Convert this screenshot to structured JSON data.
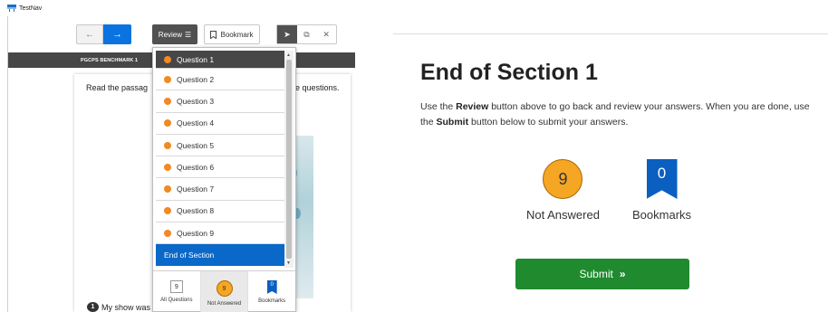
{
  "left": {
    "app_title": "TestNav",
    "section_title": "PGCPS BENCHMARK 1",
    "toolbar": {
      "prev_icon": "←",
      "next_icon": "→",
      "review_label": "Review",
      "review_icon": "☰",
      "bookmark_label": "Bookmark",
      "pointer_icon": "➤",
      "window_icon": "⧉",
      "close_icon": "✕"
    },
    "passage_text_left": "Read the passag",
    "passage_text_right": "e questions.",
    "numbered_item": {
      "number": "1",
      "text": "My show was"
    },
    "review_panel": {
      "questions": [
        "Question 1",
        "Question 2",
        "Question 3",
        "Question 4",
        "Question 5",
        "Question 6",
        "Question 7",
        "Question 8",
        "Question 9"
      ],
      "end_label": "End of Section",
      "filters": {
        "all": {
          "label": "All Questions",
          "count": "9"
        },
        "not_answered": {
          "label": "Not Answered",
          "count": "9"
        },
        "bookmarks": {
          "label": "Bookmarks",
          "count": "0"
        }
      }
    }
  },
  "right": {
    "title": "End of Section 1",
    "instructions": {
      "p1": "Use the ",
      "b1": "Review",
      "p2": " button above to go back and review your answers. When you are done, use the ",
      "b2": "Submit",
      "p3": " button below to submit your answers."
    },
    "not_answered": {
      "count": "9",
      "label": "Not Answered"
    },
    "bookmarks": {
      "count": "0",
      "label": "Bookmarks"
    },
    "submit_label": "Submit",
    "submit_icon": "»"
  },
  "colors": {
    "accent_blue": "#0a73e0",
    "orange": "#f5a623",
    "submit_green": "#1f8b2e",
    "dark_gray": "#474747"
  }
}
